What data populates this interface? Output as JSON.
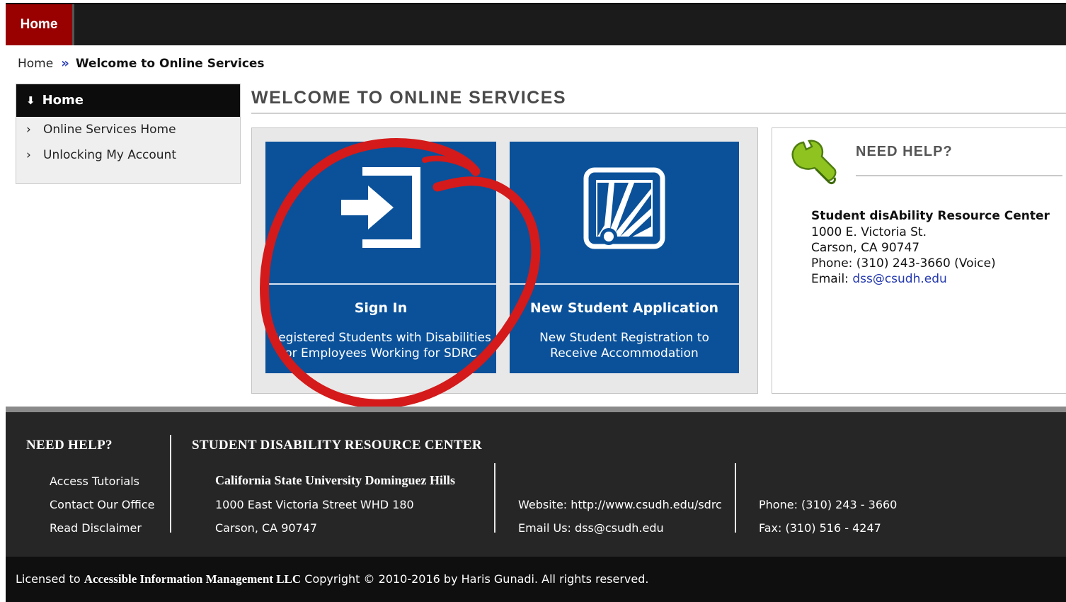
{
  "nav": {
    "home_tab": "Home"
  },
  "breadcrumb": {
    "root": "Home",
    "separator": "»",
    "current": "Welcome to Online Services"
  },
  "sidebar": {
    "header": "Home",
    "items": [
      {
        "label": "Online Services Home"
      },
      {
        "label": "Unlocking My Account"
      }
    ]
  },
  "page": {
    "title": "WELCOME TO ONLINE SERVICES"
  },
  "tiles": [
    {
      "title": "Sign In",
      "desc_line1": "Registered Students with Disabilities",
      "desc_line2": "or Employees Working for SDRC",
      "icon": "sign-in-icon"
    },
    {
      "title": "New Student Application",
      "desc_line1": "New Student Registration to",
      "desc_line2": "Receive Accommodation",
      "icon": "sunrise-icon"
    }
  ],
  "help": {
    "heading": "NEED HELP?",
    "org": "Student disAbility Resource Center",
    "address1": "1000 E. Victoria St.",
    "address2": "Carson, CA 90747",
    "phone": "Phone: (310) 243-3660 (Voice)",
    "email_label": "Email:",
    "email": "dss@csudh.edu"
  },
  "footer": {
    "need_help_heading": "NEED HELP?",
    "links": [
      "Access Tutorials",
      "Contact Our Office",
      "Read Disclaimer"
    ],
    "center_heading": "STUDENT DISABILITY RESOURCE CENTER",
    "university": "California State University Dominguez Hills",
    "street": "1000 East Victoria Street WHD 180",
    "city": "Carson, CA 90747",
    "website": "Website: http://www.csudh.edu/sdrc",
    "email": "Email Us: dss@csudh.edu",
    "phone": "Phone: (310) 243 - 3660",
    "fax": "Fax: (310) 516 - 4247"
  },
  "copyright": {
    "prefix": "Licensed to",
    "company": "Accessible Information Management LLC",
    "suffix": "Copyright © 2010-2016 by Haris Gunadi. All rights reserved."
  },
  "colors": {
    "brand_red": "#990000",
    "tile_blue": "#0a519a",
    "annotation_red": "#d41a1a",
    "link_blue": "#2338b0"
  }
}
